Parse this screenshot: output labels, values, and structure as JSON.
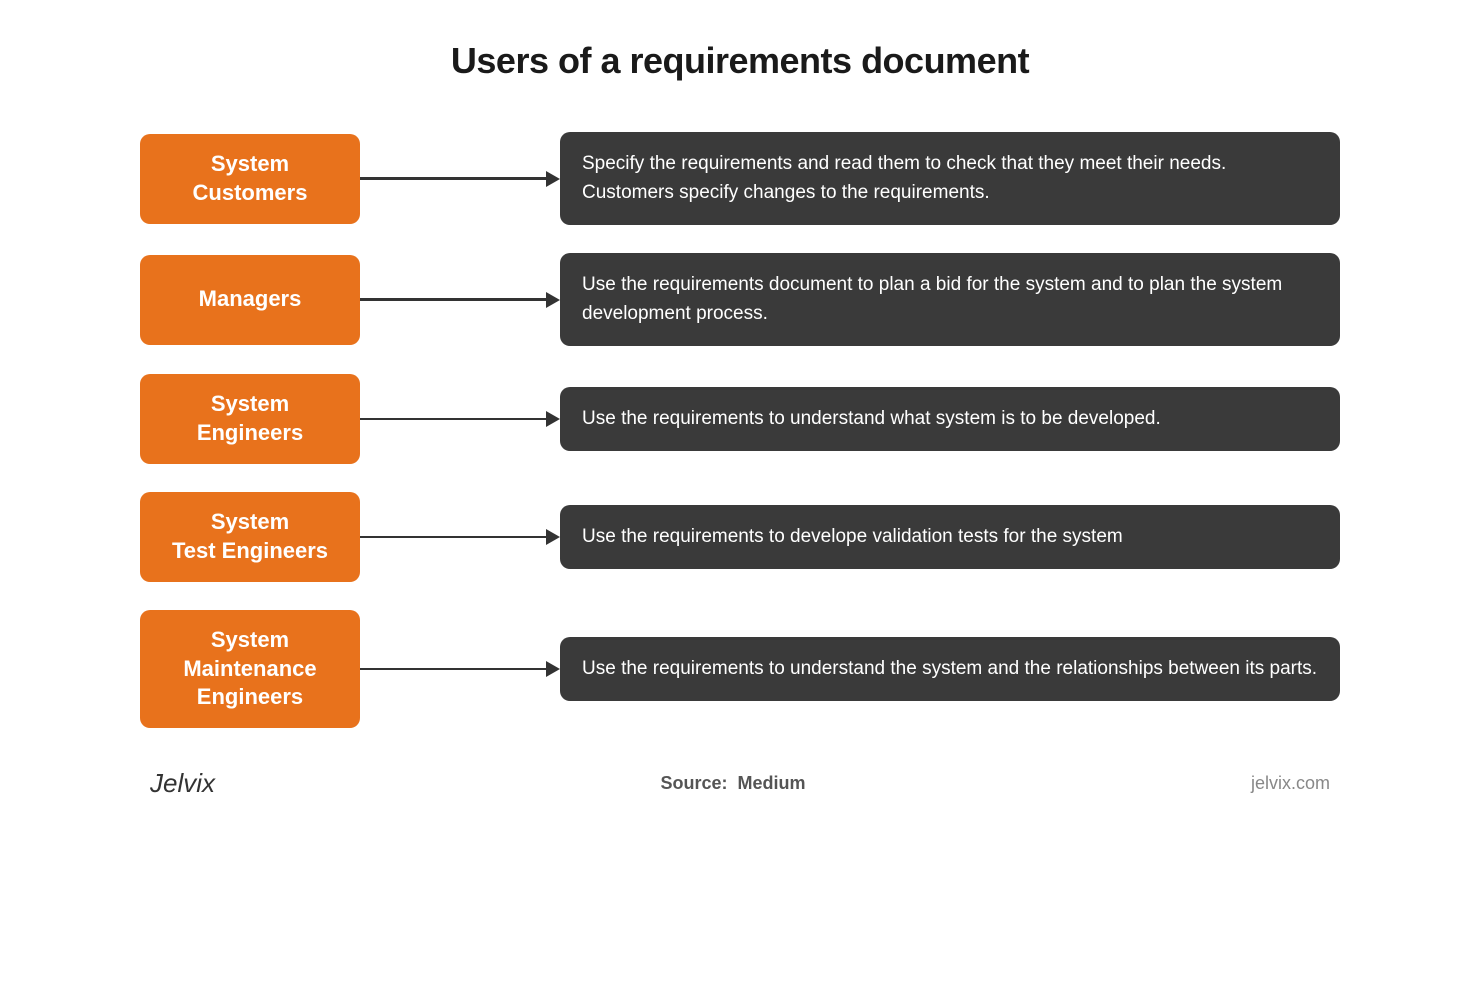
{
  "title": "Users of a requirements document",
  "rows": [
    {
      "id": "system-customers",
      "label": "System\nCustomers",
      "description": "Specify the requirements and read them to check that they meet their needs. Customers specify changes to the requirements."
    },
    {
      "id": "managers",
      "label": "Managers",
      "description": "Use the requirements document to plan a bid for the system and to plan the system development process."
    },
    {
      "id": "system-engineers",
      "label": "System\nEngineers",
      "description": "Use the requirements to understand what system is to be developed."
    },
    {
      "id": "system-test-engineers",
      "label": "System\nTest Engineers",
      "description": "Use the requirements to develope validation tests for the system"
    },
    {
      "id": "system-maintenance-engineers",
      "label": "System\nMaintenance\nEngineers",
      "description": "Use the requirements to understand the system and the relationships between its parts."
    }
  ],
  "footer": {
    "logo": "Jelvix",
    "source_label": "Source:",
    "source_value": "Medium",
    "url": "jelvix.com"
  }
}
